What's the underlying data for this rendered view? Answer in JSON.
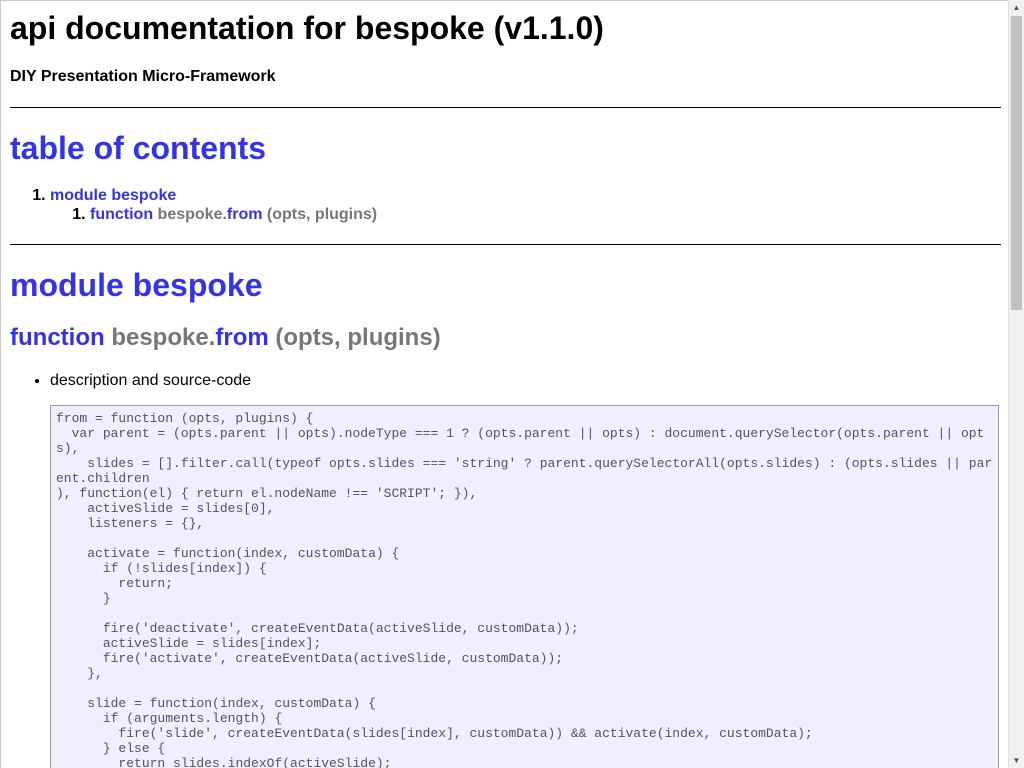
{
  "document": {
    "title": "api documentation for bespoke (v1.1.0)",
    "subtitle": "DIY Presentation Micro-Framework"
  },
  "toc": {
    "heading": "table of contents",
    "module_link": "module bespoke",
    "function_keyword": "function",
    "function_namespace": "bespoke.",
    "function_name": "from",
    "function_params": "(opts, plugins)"
  },
  "module": {
    "heading": "module bespoke",
    "function_keyword": "function",
    "function_namespace": "bespoke.",
    "function_name": "from",
    "function_params": "(opts, plugins)",
    "description_item": "description and source-code",
    "source_code": "from = function (opts, plugins) {\n  var parent = (opts.parent || opts).nodeType === 1 ? (opts.parent || opts) : document.querySelector(opts.parent || opts),\n    slides = [].filter.call(typeof opts.slides === 'string' ? parent.querySelectorAll(opts.slides) : (opts.slides || parent.children\n), function(el) { return el.nodeName !== 'SCRIPT'; }),\n    activeSlide = slides[0],\n    listeners = {},\n\n    activate = function(index, customData) {\n      if (!slides[index]) {\n        return;\n      }\n\n      fire('deactivate', createEventData(activeSlide, customData));\n      activeSlide = slides[index];\n      fire('activate', createEventData(activeSlide, customData));\n    },\n\n    slide = function(index, customData) {\n      if (arguments.length) {\n        fire('slide', createEventData(slides[index], customData)) && activate(index, customData);\n      } else {\n        return slides.indexOf(activeSlide);"
  },
  "colors": {
    "link": "#3333ee",
    "muted": "#777777",
    "code_background": "#eeeeff"
  }
}
